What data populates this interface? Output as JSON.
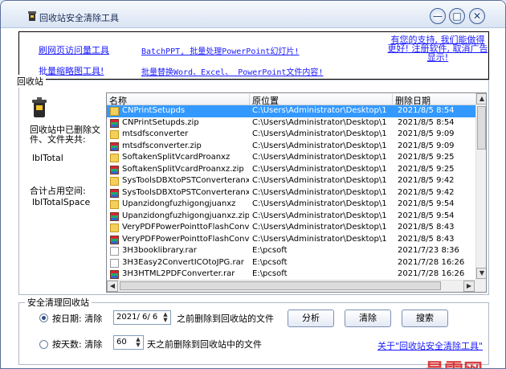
{
  "window": {
    "title": "回收站安全清除工具",
    "min_glyph": "—",
    "max_glyph": "□",
    "close_glyph": "✕"
  },
  "links": {
    "visit_tool": "刷网页访问量工具",
    "batch_ppt": "BatchPPT, 批量处理PowerPoint幻灯片!",
    "thumbnail_tool": "批量缩略图工具!",
    "batch_replace": "批量替换Word、Excel、 PowerPoint文件内容!",
    "support": "有您的支持, 我们能做得更好! 注册软件, 取消广告显示!"
  },
  "recycle": {
    "group_label": "回收站",
    "deleted_label": "回收站中已删除文件、文件夹共:",
    "total_value": "lblTotal",
    "space_label": "合计占用空间:",
    "space_value": "lblTotalSpace"
  },
  "table": {
    "columns": [
      "名称",
      "原位置",
      "删除日期"
    ],
    "rows": [
      {
        "icon": "folder",
        "name": "CNPrintSetupds",
        "location": "C:\\Users\\Administrator\\Desktop\\1",
        "date": "2021/8/5 8:54",
        "selected": true
      },
      {
        "icon": "zip",
        "name": "CNPrintSetupds.zip",
        "location": "C:\\Users\\Administrator\\Desktop\\1",
        "date": "2021/8/5 8:54",
        "selected": false
      },
      {
        "icon": "folder",
        "name": "mtsdfsconverter",
        "location": "C:\\Users\\Administrator\\Desktop\\1",
        "date": "2021/8/5 9:09",
        "selected": false
      },
      {
        "icon": "zip",
        "name": "mtsdfsconverter.zip",
        "location": "C:\\Users\\Administrator\\Desktop\\1",
        "date": "2021/8/5 9:09",
        "selected": false
      },
      {
        "icon": "folder",
        "name": "SoftakenSplitVcardProanxz",
        "location": "C:\\Users\\Administrator\\Desktop\\1",
        "date": "2021/8/5 9:25",
        "selected": false
      },
      {
        "icon": "zip",
        "name": "SoftakenSplitVcardProanxz.zip",
        "location": "C:\\Users\\Administrator\\Desktop\\1",
        "date": "2021/8/5 9:25",
        "selected": false
      },
      {
        "icon": "folder",
        "name": "SysToolsDBXtoPSTConverteranxz",
        "location": "C:\\Users\\Administrator\\Desktop\\1",
        "date": "2021/8/5 9:42",
        "selected": false
      },
      {
        "icon": "zip",
        "name": "SysToolsDBXtoPSTConverteranxz.zip",
        "location": "C:\\Users\\Administrator\\Desktop\\1",
        "date": "2021/8/5 9:42",
        "selected": false
      },
      {
        "icon": "folder",
        "name": "Upanzidongfuzhigongjuanxz",
        "location": "C:\\Users\\Administrator\\Desktop\\1",
        "date": "2021/8/5 9:54",
        "selected": false
      },
      {
        "icon": "zip",
        "name": "Upanzidongfuzhigongjuanxz.zip",
        "location": "C:\\Users\\Administrator\\Desktop\\1",
        "date": "2021/8/5 9:54",
        "selected": false
      },
      {
        "icon": "folder",
        "name": "VeryPDFPowerPointtoFlashConverter...",
        "location": "C:\\Users\\Administrator\\Desktop\\1",
        "date": "2021/8/5 8:43",
        "selected": false
      },
      {
        "icon": "zip",
        "name": "VeryPDFPowerPointtoFlashConverter...",
        "location": "C:\\Users\\Administrator\\Desktop\\1",
        "date": "2021/8/5 8:43",
        "selected": false
      },
      {
        "icon": "doc",
        "name": "3H3booklibrary.rar",
        "location": "E:\\pcsoft",
        "date": "2021/7/23 8:36",
        "selected": false
      },
      {
        "icon": "doc",
        "name": "3H3Easy2ConvertICOtoJPG.rar",
        "location": "E:\\pcsoft",
        "date": "2021/7/28 16:26",
        "selected": false
      },
      {
        "icon": "zip",
        "name": "3H3HTML2PDFConverter.rar",
        "location": "E:\\pcsoft",
        "date": "2021/7/28 16:26",
        "selected": false
      }
    ]
  },
  "clean": {
    "group_label": "安全清理回收站",
    "by_date_label": "按日期: 清除",
    "date_value": "2021/ 6/ 6",
    "date_suffix": "之前删除到回收站的文件",
    "by_days_label": "按天数: 清除",
    "days_value": "60",
    "days_suffix": "天之前删除到回收站中的文件",
    "analyze": "分析",
    "clear": "清除",
    "search": "搜索",
    "about": "关于\"回收站安全清除工具\""
  },
  "watermark": "最需网"
}
